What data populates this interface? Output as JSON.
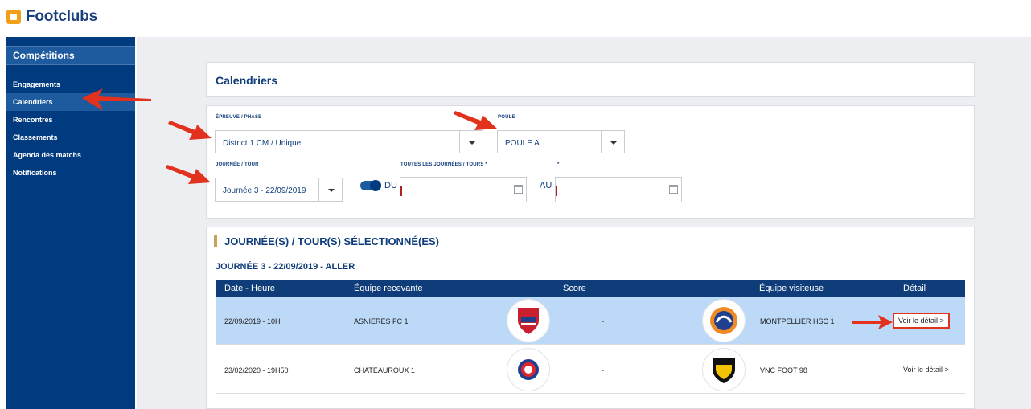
{
  "app": {
    "logo_text": "Footclubs"
  },
  "sidebar": {
    "header": "Compétitions",
    "items": [
      {
        "label": "Engagements"
      },
      {
        "label": "Calendriers",
        "active": true
      },
      {
        "label": "Rencontres"
      },
      {
        "label": "Classements"
      },
      {
        "label": "Agenda des matchs"
      },
      {
        "label": "Notifications"
      }
    ]
  },
  "page": {
    "title": "Calendriers"
  },
  "filters": {
    "epreuve_label": "ÉPREUVE / PHASE",
    "epreuve_value": "District 1 CM / Unique",
    "poule_label": "POULE",
    "poule_value": "POULE A",
    "journee_label": "JOURNÉE / TOUR",
    "journee_value": "Journée 3 - 22/09/2019",
    "all_rounds_label": "TOUTES LES JOURNÉES / TOURS *",
    "asterisk": "*",
    "du_label": "DU",
    "au_label": "AU"
  },
  "results": {
    "section_title": "JOURNÉE(S) / TOUR(S) SÉLECTIONNÉ(ES)",
    "round_title": "JOURNÉE 3 - 22/09/2019 - ALLER",
    "columns": [
      "Date - Heure",
      "Équipe recevante",
      "Score",
      "Équipe visiteuse",
      "Détail"
    ],
    "rows": [
      {
        "date": "22/09/2019 - 10H",
        "home": "ASNIERES FC 1",
        "score": "-",
        "away": "MONTPELLIER HSC 1",
        "detail": "Voir le détail >",
        "home_crest_color": "#c8202f",
        "away_crest_color": "#f08a24"
      },
      {
        "date": "23/02/2020 - 19H50",
        "home": "CHATEAUROUX 1",
        "score": "-",
        "away": "VNC FOOT 98",
        "detail": "Voir le détail >",
        "home_crest_color": "#1f3f8f",
        "away_crest_color": "#f2c300"
      }
    ]
  },
  "colors": {
    "brand_blue": "#003b80",
    "accent_orange": "#f2a01a",
    "highlight_row": "#bcd9f7",
    "callout_red": "#e2311d"
  }
}
